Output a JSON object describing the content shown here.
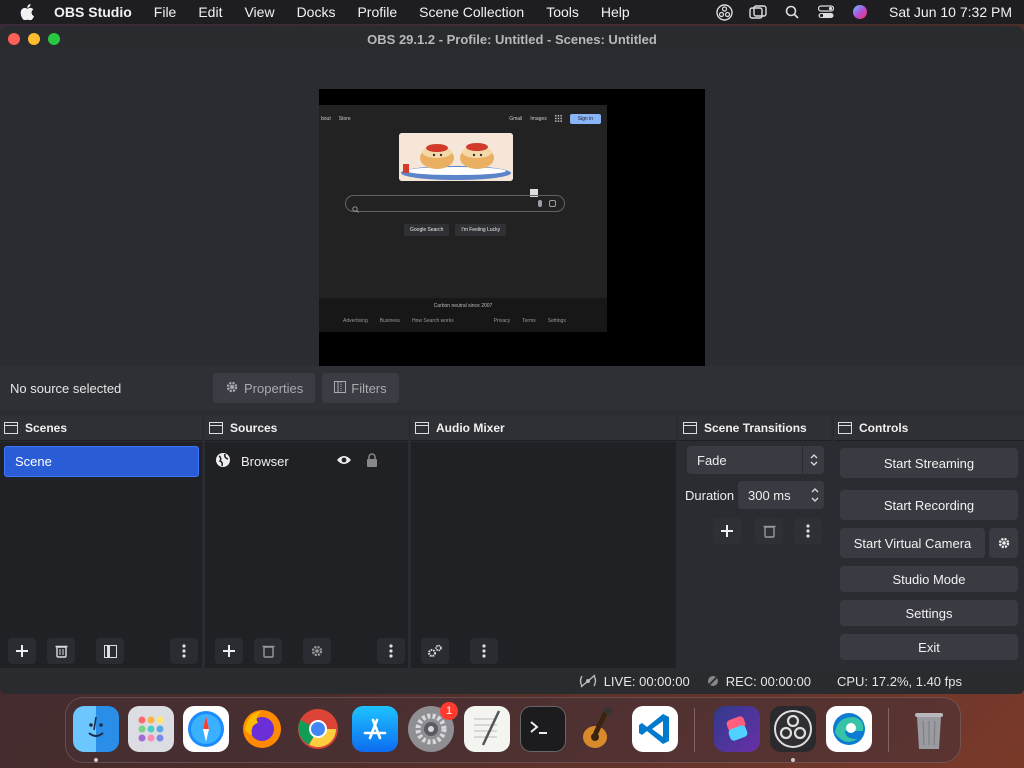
{
  "menubar": {
    "app_name": "OBS Studio",
    "items": [
      "File",
      "Edit",
      "View",
      "Docks",
      "Profile",
      "Scene Collection",
      "Tools",
      "Help"
    ],
    "clock": "Sat Jun 10  7:32 PM"
  },
  "window": {
    "title": "OBS 29.1.2 - Profile: Untitled - Scenes: Untitled"
  },
  "preview": {
    "page": {
      "nav_left": [
        "bout",
        "Store"
      ],
      "nav_right": [
        "Gmail",
        "Images"
      ],
      "sign_in": "Sign in",
      "buttons": [
        "Google Search",
        "I'm Feeling Lucky"
      ],
      "carbon": "Carbon neutral since 2007",
      "footer": [
        "Advertising",
        "Business",
        "How Search works",
        "Privacy",
        "Terms",
        "Settings"
      ]
    }
  },
  "source_bar": {
    "no_source": "No source selected",
    "properties": "Properties",
    "filters": "Filters"
  },
  "scenes": {
    "title": "Scenes",
    "items": [
      "Scene"
    ]
  },
  "sources": {
    "title": "Sources",
    "items": [
      "Browser"
    ]
  },
  "audio_mixer": {
    "title": "Audio Mixer"
  },
  "transitions": {
    "title": "Scene Transitions",
    "selected": "Fade",
    "duration_label": "Duration",
    "duration_value": "300 ms"
  },
  "controls": {
    "title": "Controls",
    "start_streaming": "Start Streaming",
    "start_recording": "Start Recording",
    "start_virtual_camera": "Start Virtual Camera",
    "studio_mode": "Studio Mode",
    "settings": "Settings",
    "exit": "Exit"
  },
  "status": {
    "live": "LIVE: 00:00:00",
    "rec": "REC: 00:00:00",
    "cpu": "CPU: 17.2%, 1.40 fps"
  },
  "dock": {
    "settings_badge": "1",
    "apps": [
      "finder-icon",
      "launchpad-icon",
      "safari-icon",
      "firefox-icon",
      "chrome-icon",
      "app-store-icon",
      "system-settings-icon",
      "textedit-icon",
      "terminal-icon",
      "garageband-icon",
      "vscode-icon",
      "shortcuts-icon",
      "obs-icon",
      "edge-icon",
      "trash-icon"
    ]
  },
  "colors": {
    "accent": "#2a5cd6",
    "window_bg": "#2b2c31",
    "panel_bg": "#202125",
    "button_bg": "#3a3b42"
  }
}
